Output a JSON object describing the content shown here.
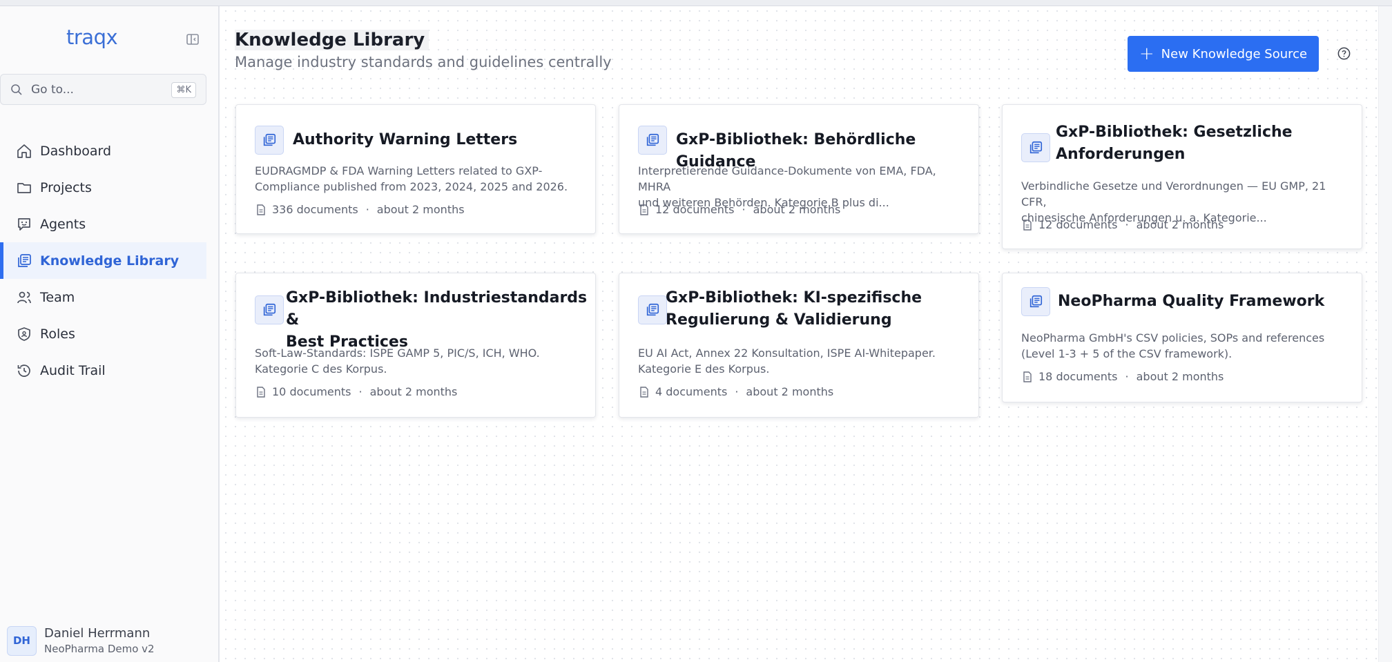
{
  "app": {
    "brand": "traqx"
  },
  "sidebar": {
    "search": {
      "label": "Go to...",
      "shortcut": "⌘K"
    },
    "items": [
      {
        "label": "Dashboard",
        "icon": "home-icon"
      },
      {
        "label": "Projects",
        "icon": "folder-icon"
      },
      {
        "label": "Agents",
        "icon": "agent-icon"
      },
      {
        "label": "Knowledge Library",
        "icon": "library-icon",
        "active": true
      },
      {
        "label": "Team",
        "icon": "team-icon"
      },
      {
        "label": "Roles",
        "icon": "shield-icon"
      },
      {
        "label": "Audit Trail",
        "icon": "history-icon"
      }
    ],
    "user": {
      "initials": "DH",
      "name": "Daniel Herrmann",
      "org": "NeoPharma Demo v2"
    }
  },
  "header": {
    "title": "Knowledge Library",
    "subtitle": "Manage industry standards and guidelines centrally",
    "new_button": "New Knowledge Source"
  },
  "cards": [
    {
      "title_line1": "Authority Warning Letters",
      "title_line2": "",
      "desc_line1": "EUDRAGMDP & FDA Warning Letters related to GXP-",
      "desc_line2": "Compliance published from 2023, 2024, 2025 and 2026.",
      "documents": "336 documents",
      "age": "about 2 months"
    },
    {
      "title_line1": "GxP-Bibliothek: Behördliche Guidance",
      "title_line2": "",
      "desc_line1": "Interpretierende Guidance-Dokumente von EMA, FDA, MHRA",
      "desc_line2": "und weiteren Behörden. Kategorie B plus di...",
      "documents": "12 documents",
      "age": "about 2 months"
    },
    {
      "title_line1": "GxP-Bibliothek: Gesetzliche",
      "title_line2": "Anforderungen",
      "desc_line1": "Verbindliche Gesetze und Verordnungen — EU GMP, 21 CFR,",
      "desc_line2": "chinesische Anforderungen u. a. Kategorie...",
      "documents": "12 documents",
      "age": "about 2 months"
    },
    {
      "title_line1": "GxP-Bibliothek: Industriestandards &",
      "title_line2": "Best Practices",
      "desc_line1": "Soft-Law-Standards: ISPE GAMP 5, PIC/S, ICH, WHO.",
      "desc_line2": "Kategorie C des Korpus.",
      "documents": "10 documents",
      "age": "about 2 months"
    },
    {
      "title_line1": "GxP-Bibliothek: KI-spezifische",
      "title_line2": "Regulierung & Validierung",
      "desc_line1": "EU AI Act, Annex 22 Konsultation, ISPE AI-Whitepaper.",
      "desc_line2": "Kategorie E des Korpus.",
      "documents": "4 documents",
      "age": "about 2 months"
    },
    {
      "title_line1": "NeoPharma Quality Framework",
      "title_line2": "",
      "desc_line1": "NeoPharma GmbH's CSV policies, SOPs and references",
      "desc_line2": "(Level 1-3 + 5 of the CSV framework).",
      "documents": "18 documents",
      "age": "about 2 months"
    }
  ],
  "colors": {
    "accent": "#2b6ef2",
    "active_bg": "#eef3fd",
    "active_text": "#2f64d6"
  }
}
